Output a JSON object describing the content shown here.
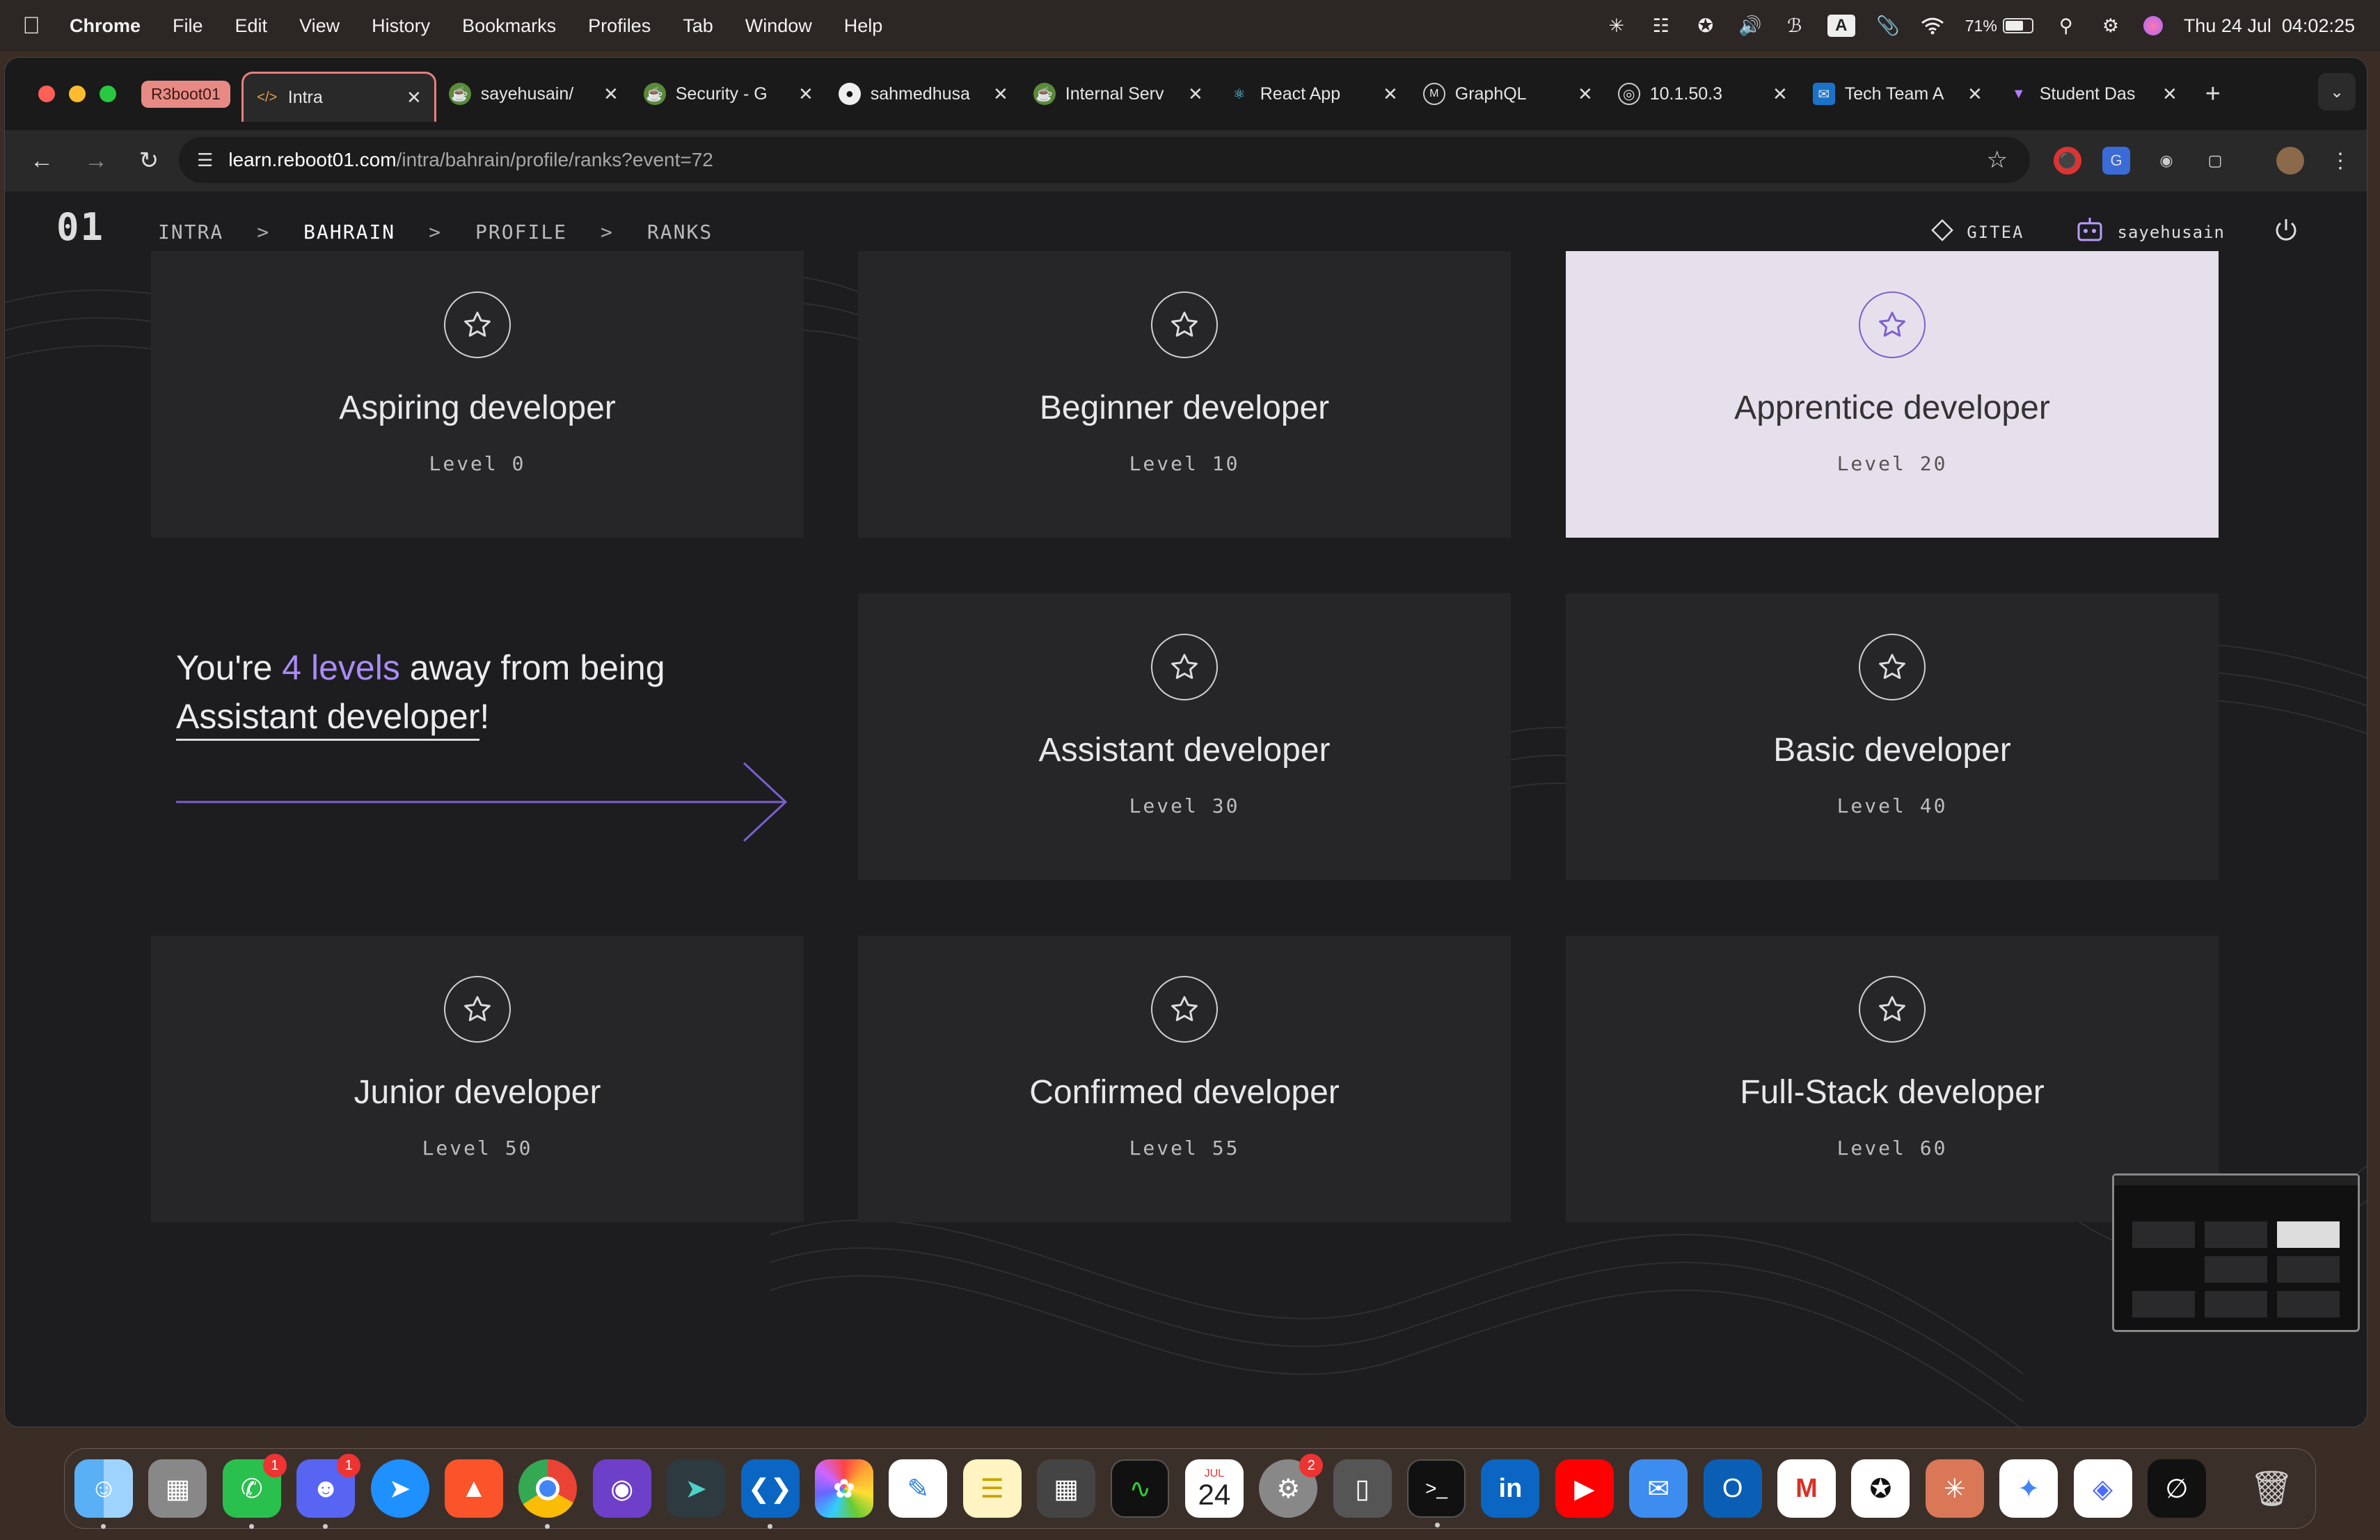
{
  "menubar": {
    "app": "Chrome",
    "items": [
      "File",
      "Edit",
      "View",
      "History",
      "Bookmarks",
      "Profiles",
      "Tab",
      "Window",
      "Help"
    ],
    "battery": "71%",
    "battery_level": 0.71,
    "input_source": "A",
    "clock": "Thu 24 Jul  04:02:25"
  },
  "tabs": {
    "group_label": "R3boot01",
    "items": [
      {
        "label": "Intra",
        "icon": "code-icon"
      },
      {
        "label": "sayehusain/",
        "icon": "gitea-icon"
      },
      {
        "label": "Security - G",
        "icon": "gitea-icon"
      },
      {
        "label": "sahmedhusa",
        "icon": "github-icon"
      },
      {
        "label": "Internal Serv",
        "icon": "gitea-icon"
      },
      {
        "label": "React App",
        "icon": "react-icon"
      },
      {
        "label": "GraphQL",
        "icon": "graphql-icon"
      },
      {
        "label": "10.1.50.3",
        "icon": "globe-icon"
      },
      {
        "label": "Tech Team A",
        "icon": "outlook-icon"
      },
      {
        "label": "Student Das",
        "icon": "vite-icon"
      }
    ]
  },
  "address": {
    "domain": "learn.reboot01.com",
    "path": "/intra/bahrain/profile/ranks?event=72"
  },
  "site": {
    "logo": "01",
    "breadcrumb": {
      "a": "INTRA",
      "b": "BAHRAIN",
      "c": "PROFILE",
      "d": "RANKS",
      "sep": ">"
    },
    "gitea": "GITEA",
    "user": "sayehusain"
  },
  "progress": {
    "pre": "You're ",
    "count": "4 levels",
    "mid": " away from being",
    "next_rank": "Assistant developer",
    "end": "!"
  },
  "ranks": [
    {
      "title": "Aspiring developer",
      "level": "Level 0"
    },
    {
      "title": "Beginner developer",
      "level": "Level 10"
    },
    {
      "title": "Apprentice developer",
      "level": "Level 20"
    },
    {
      "title": "Assistant developer",
      "level": "Level 30"
    },
    {
      "title": "Basic developer",
      "level": "Level 40"
    },
    {
      "title": "Junior developer",
      "level": "Level 50"
    },
    {
      "title": "Confirmed developer",
      "level": "Level 55"
    },
    {
      "title": "Full-Stack developer",
      "level": "Level 60"
    }
  ],
  "dock": {
    "calendar_month": "JUL",
    "calendar_day": "24",
    "badges": {
      "whatsapp": "1",
      "discord": "1",
      "settings": "2"
    }
  },
  "colors": {
    "accent": "#a98cf5",
    "active_card": "#e6e0ec",
    "tab_highlight": "#e87f7f"
  }
}
